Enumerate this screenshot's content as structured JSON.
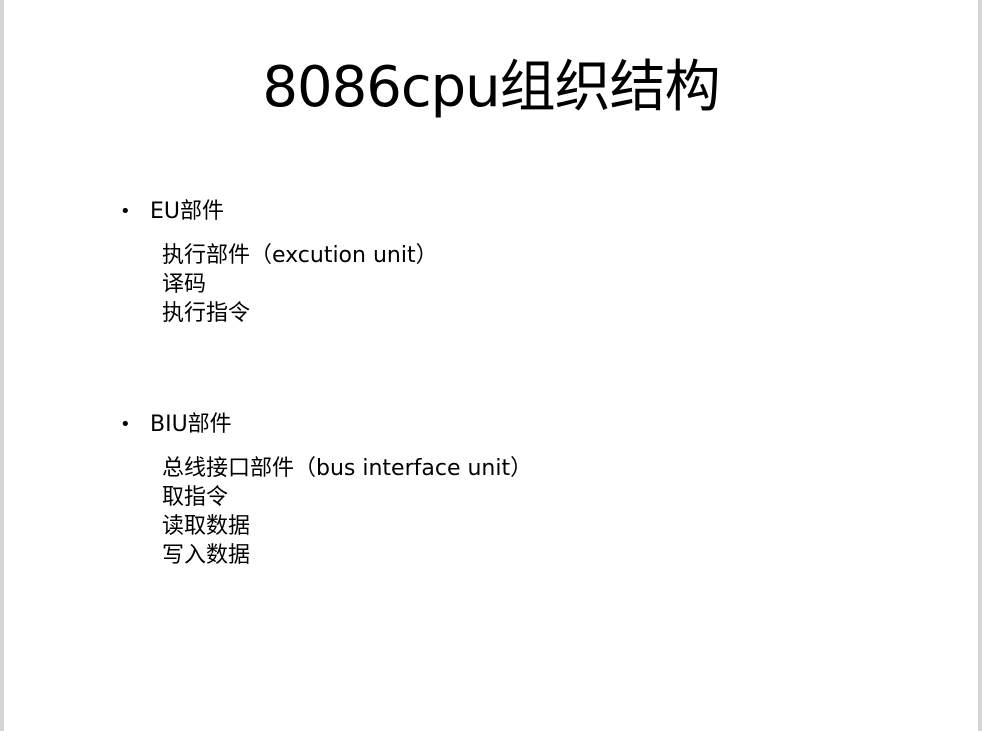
{
  "slide": {
    "title": "8086cpu组织结构",
    "sections": [
      {
        "bullet": "•",
        "heading": "EU部件",
        "items": [
          "执行部件（excution unit）",
          "译码",
          "执行指令"
        ]
      },
      {
        "bullet": "•",
        "heading": "BIU部件",
        "items": [
          "总线接口部件（bus interface unit）",
          "取指令",
          "读取数据",
          "写入数据"
        ]
      }
    ]
  }
}
